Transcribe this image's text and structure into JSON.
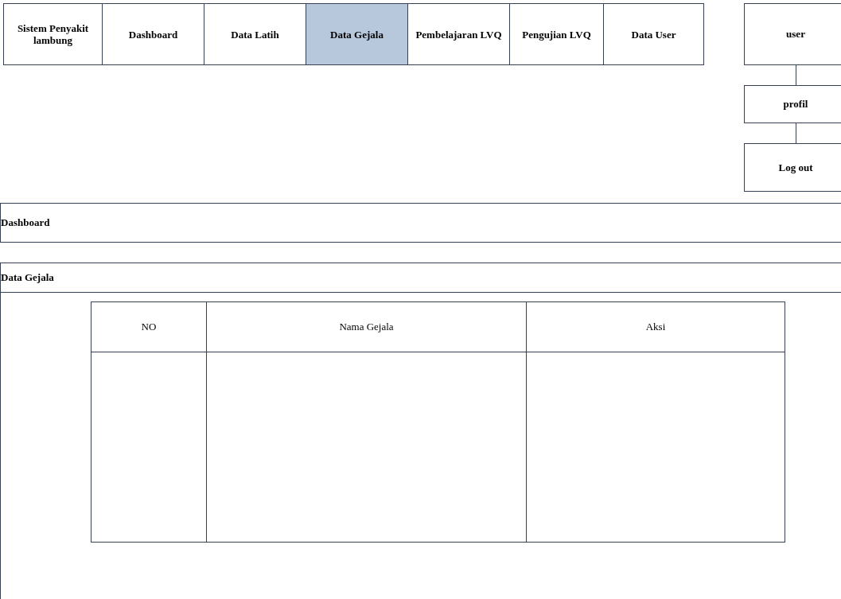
{
  "nav": [
    {
      "label": "Sistem Penyakit lambung",
      "selected": false
    },
    {
      "label": "Dashboard",
      "selected": false
    },
    {
      "label": "Data Latih",
      "selected": false
    },
    {
      "label": "Data Gejala",
      "selected": true
    },
    {
      "label": "Pembelajaran LVQ",
      "selected": false
    },
    {
      "label": "Pengujian LVQ",
      "selected": false
    },
    {
      "label": "Data User",
      "selected": false
    }
  ],
  "user_menu": {
    "label": "user",
    "items": [
      "profil",
      "Log out"
    ]
  },
  "breadcrumb": "Dashboard",
  "panel": {
    "title": "Data Gejala",
    "table": {
      "columns": [
        "NO",
        "Nama Gejala",
        "Aksi"
      ]
    }
  }
}
